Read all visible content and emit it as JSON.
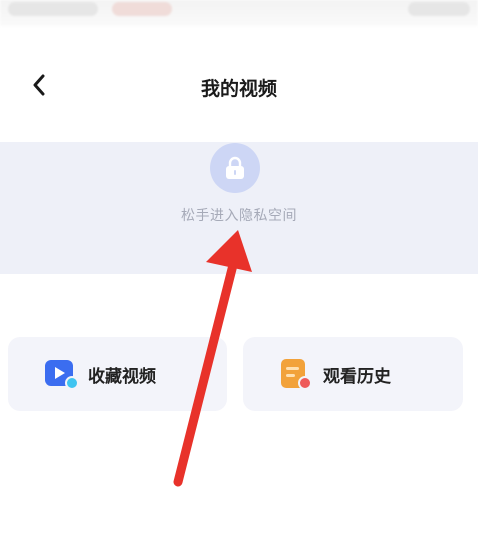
{
  "header": {
    "title": "我的视频",
    "back_icon": "chevron-left-icon"
  },
  "private_space": {
    "hint": "松手进入隐私空间",
    "icon": "lock-icon",
    "color": "#cdd6f5"
  },
  "cards": [
    {
      "label": "收藏视频",
      "icon": "play-video-icon",
      "color": "#3b6df0"
    },
    {
      "label": "观看历史",
      "icon": "history-note-icon",
      "color": "#f2a23a"
    }
  ],
  "annotation": {
    "icon": "red-arrow-icon",
    "color": "#e8322a"
  }
}
